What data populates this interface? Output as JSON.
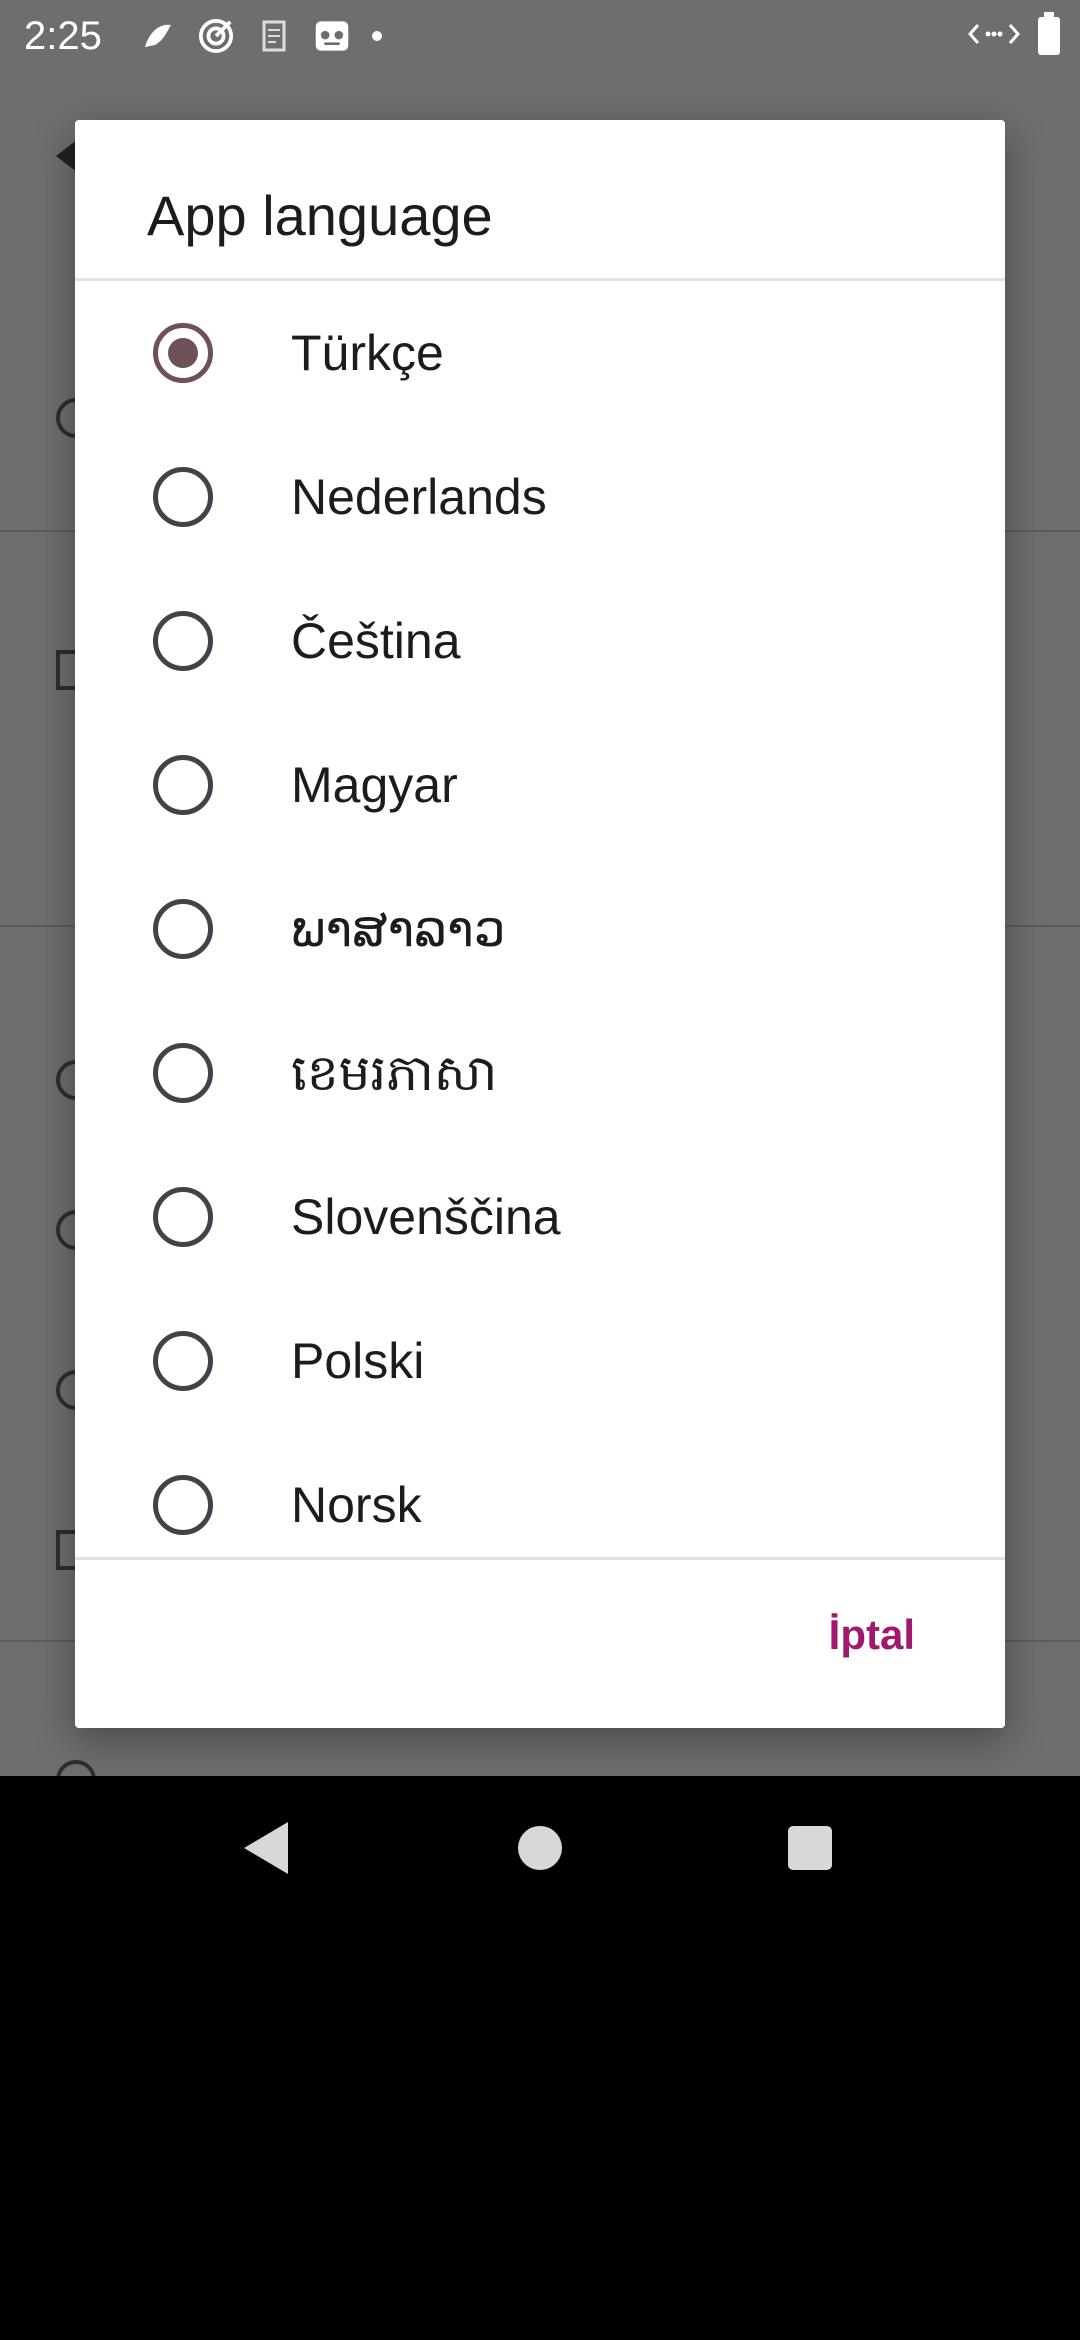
{
  "status_bar": {
    "time": "2:25",
    "left_icons": [
      "notification-app-icon",
      "target-app-icon",
      "receipt-app-icon",
      "incognito-app-icon",
      "more-dot-icon"
    ],
    "right_icons": [
      "data-transfer-icon",
      "battery-icon"
    ]
  },
  "dialog": {
    "title": "App language",
    "options": [
      {
        "label": "Türkçe",
        "selected": true
      },
      {
        "label": "Nederlands",
        "selected": false
      },
      {
        "label": "Čeština",
        "selected": false
      },
      {
        "label": "Magyar",
        "selected": false
      },
      {
        "label": "ພາສາລາວ",
        "selected": false
      },
      {
        "label": "ខេមរភាសា",
        "selected": false
      },
      {
        "label": "Slovenščina",
        "selected": false
      },
      {
        "label": "Polski",
        "selected": false
      },
      {
        "label": "Norsk",
        "selected": false
      }
    ],
    "cancel_label": "İptal"
  },
  "navigation": {
    "buttons": [
      "back-icon",
      "home-icon",
      "recents-icon"
    ]
  },
  "colors": {
    "accent": "#a0196e",
    "radio_checked": "#6c5156",
    "radio_unchecked": "#45414a",
    "scrim": "#6e6e6e"
  }
}
